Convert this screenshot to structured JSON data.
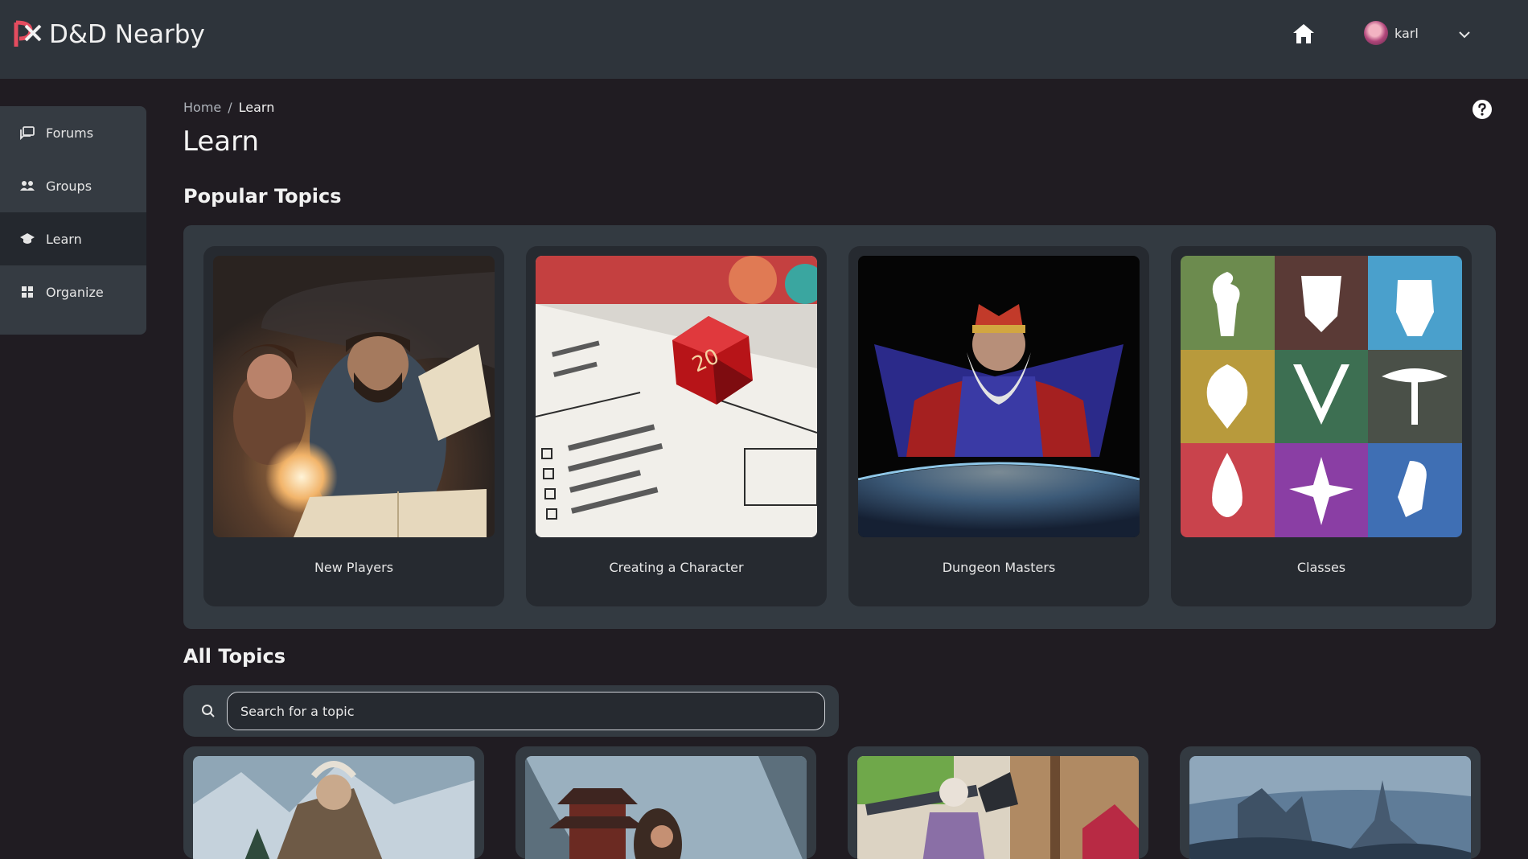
{
  "app": {
    "name": "D&D Nearby"
  },
  "header": {
    "user_name": "karl"
  },
  "sidebar": {
    "items": [
      {
        "label": "Forums",
        "icon": "forums-icon"
      },
      {
        "label": "Groups",
        "icon": "groups-icon"
      },
      {
        "label": "Learn",
        "icon": "graduation-cap-icon",
        "active": true
      },
      {
        "label": "Organize",
        "icon": "grid-icon"
      }
    ]
  },
  "breadcrumb": {
    "home": "Home",
    "separator": "/",
    "current": "Learn"
  },
  "page": {
    "title": "Learn"
  },
  "popular": {
    "heading": "Popular Topics",
    "cards": [
      {
        "label": "New Players"
      },
      {
        "label": "Creating a Character"
      },
      {
        "label": "Dungeon Masters"
      },
      {
        "label": "Classes"
      }
    ]
  },
  "all_topics": {
    "heading": "All Topics",
    "search_placeholder": "Search for a topic"
  },
  "colors": {
    "background": "#201c22",
    "topbar": "#2e343b",
    "panel": "#333a41",
    "card": "#262a30",
    "brand_accent": "#e44c5f"
  }
}
